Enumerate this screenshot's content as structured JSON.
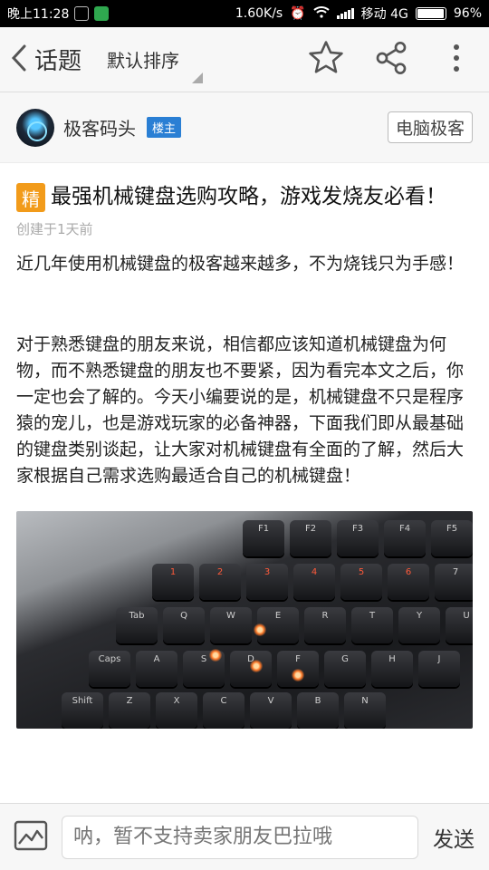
{
  "status_bar": {
    "time": "晚上11:28",
    "speed": "1.60K/s",
    "carrier": "移动 4G",
    "battery": "96%"
  },
  "header": {
    "back_icon": "chevron-left-icon",
    "title": "话题",
    "sort_label": "默认排序",
    "actions": [
      "star-icon",
      "share-icon",
      "more-vertical-icon"
    ]
  },
  "author": {
    "name": "极客码头",
    "badge": "楼主",
    "forum_button": "电脑极客"
  },
  "post": {
    "tag": "精",
    "title": "最强机械键盘选购攻略，游戏发烧友必看！",
    "created": "创建于1天前",
    "lead": "近几年使用机械键盘的极客越来越多，不为烧钱只为手感！",
    "body": "对于熟悉键盘的朋友来说，相信都应该知道机械键盘为何物，而不熟悉键盘的朋友也不要紧，因为看完本文之后，你一定也会了解的。今天小编要说的是，机械键盘不只是程序猿的宠儿，也是游戏玩家的必备神器，下面我们即从最基础的键盘类别谈起，让大家对机械键盘有全面的了解，然后大家根据自己需求选购最适合自己的机械键盘！"
  },
  "reply_bar": {
    "image_icon": "image-icon",
    "placeholder": "呐，暂不支持卖家朋友巴拉哦",
    "send_label": "发送"
  }
}
